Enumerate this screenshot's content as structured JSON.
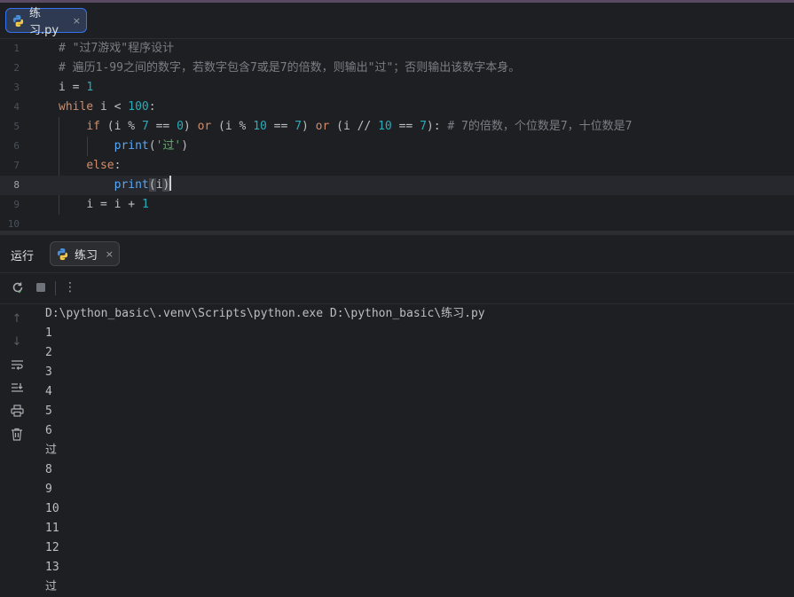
{
  "editor": {
    "file_tab": {
      "label": "练习.py",
      "close": "×"
    },
    "lines": [
      {
        "n": "1"
      },
      {
        "n": "2"
      },
      {
        "n": "3"
      },
      {
        "n": "4"
      },
      {
        "n": "5"
      },
      {
        "n": "6"
      },
      {
        "n": "7"
      },
      {
        "n": "8"
      },
      {
        "n": "9"
      },
      {
        "n": "10"
      }
    ],
    "code": {
      "l1_comment": "# \"过7游戏\"程序设计",
      "l2_comment": "# 遍历1-99之间的数字，若数字包含7或是7的倍数，则输出\"过\"；否则输出该数字本身。",
      "l3_var": "i",
      "l3_op": " = ",
      "l3_num": "1",
      "l4_kw": "while",
      "l4_rest": " i < ",
      "l4_num": "100",
      "l4_colon": ":",
      "l5_kw_if": "if",
      "l5_p1": " (i % ",
      "l5_n7": "7",
      "l5_p2": " == ",
      "l5_n0": "0",
      "l5_p3": ") ",
      "l5_or1": "or",
      "l5_p4": " (i % ",
      "l5_n10a": "10",
      "l5_p5": " == ",
      "l5_n7b": "7",
      "l5_p6": ") ",
      "l5_or2": "or",
      "l5_p7": " (i // ",
      "l5_n10b": "10",
      "l5_p8": " == ",
      "l5_n7c": "7",
      "l5_p9": "): ",
      "l5_comment": "# 7的倍数，个位数是7，十位数是7",
      "l6_fn": "print",
      "l6_open": "(",
      "l6_str": "'过'",
      "l6_close": ")",
      "l7_kw": "else",
      "l7_colon": ":",
      "l8_fn": "print",
      "l8_open": "(",
      "l8_arg": "i",
      "l8_close": ")",
      "l9_lhs": "i = i + ",
      "l9_num": "1"
    },
    "current_line": "8"
  },
  "run_panel": {
    "title": "运行",
    "tab_label": "练习",
    "tab_close": "×",
    "toolbar": {
      "rerun_icon": "rerun-icon",
      "stop_icon": "stop-icon",
      "more_label": "⋮"
    },
    "side_icons": [
      "up-arrow-icon",
      "down-arrow-icon",
      "soft-wrap-icon",
      "scroll-to-end-icon",
      "print-icon",
      "trash-icon"
    ],
    "command": "D:\\python_basic\\.venv\\Scripts\\python.exe D:\\python_basic\\练习.py",
    "output": [
      "1",
      "2",
      "3",
      "4",
      "5",
      "6",
      "过",
      "8",
      "9",
      "10",
      "11",
      "12",
      "13",
      "过"
    ]
  },
  "colors": {
    "accent": "#3574f0",
    "keyword": "#cf8e6d",
    "number": "#2aacb8",
    "string": "#6aab73",
    "comment": "#7a7e85",
    "function": "#56a8f5"
  }
}
